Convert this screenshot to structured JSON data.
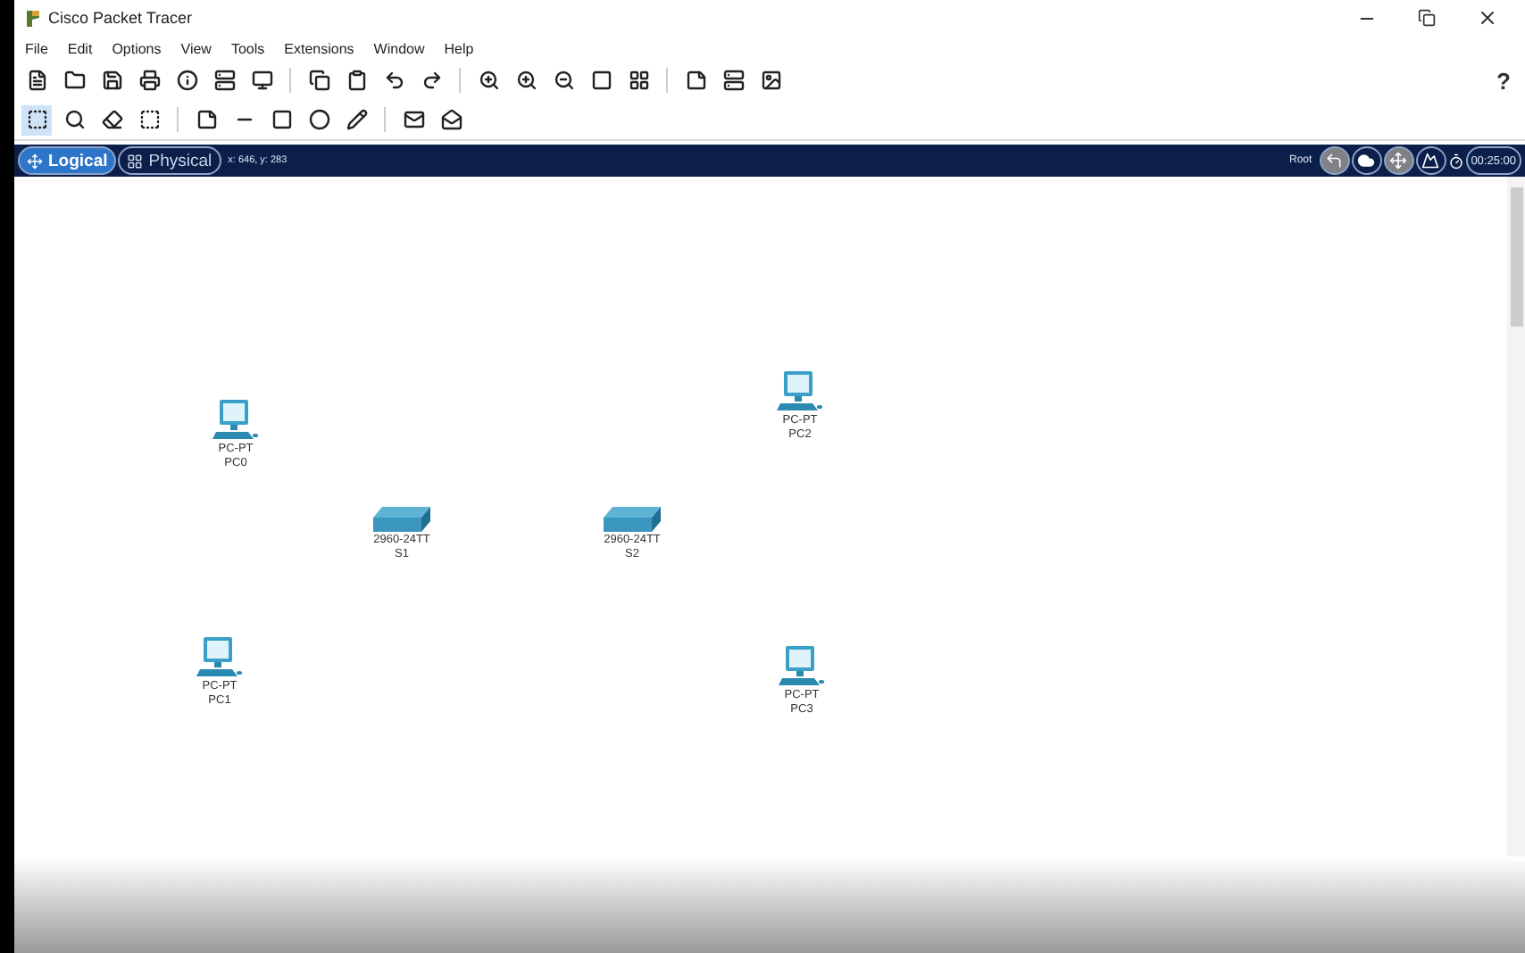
{
  "window": {
    "title": "Cisco Packet Tracer"
  },
  "menu": [
    "File",
    "Edit",
    "Options",
    "View",
    "Tools",
    "Extensions",
    "Window",
    "Help"
  ],
  "help_button": "?",
  "workspace_bar": {
    "tabs": [
      {
        "label": "Logical",
        "kind": "logical",
        "selected": true
      },
      {
        "label": "Physical",
        "kind": "physical",
        "selected": false
      }
    ],
    "coordinates": "x: 646, y: 283",
    "location": "Root",
    "time": "00:25:00"
  },
  "devices": [
    {
      "kind": "pc",
      "model": "PC-PT",
      "name": "PC0"
    },
    {
      "kind": "pc",
      "model": "PC-PT",
      "name": "PC2"
    },
    {
      "kind": "switch",
      "model": "2960-24TT",
      "name": "S1"
    },
    {
      "kind": "switch",
      "model": "2960-24TT",
      "name": "S2"
    },
    {
      "kind": "pc",
      "model": "PC-PT",
      "name": "PC1"
    },
    {
      "kind": "pc",
      "model": "PC-PT",
      "name": "PC3"
    }
  ]
}
